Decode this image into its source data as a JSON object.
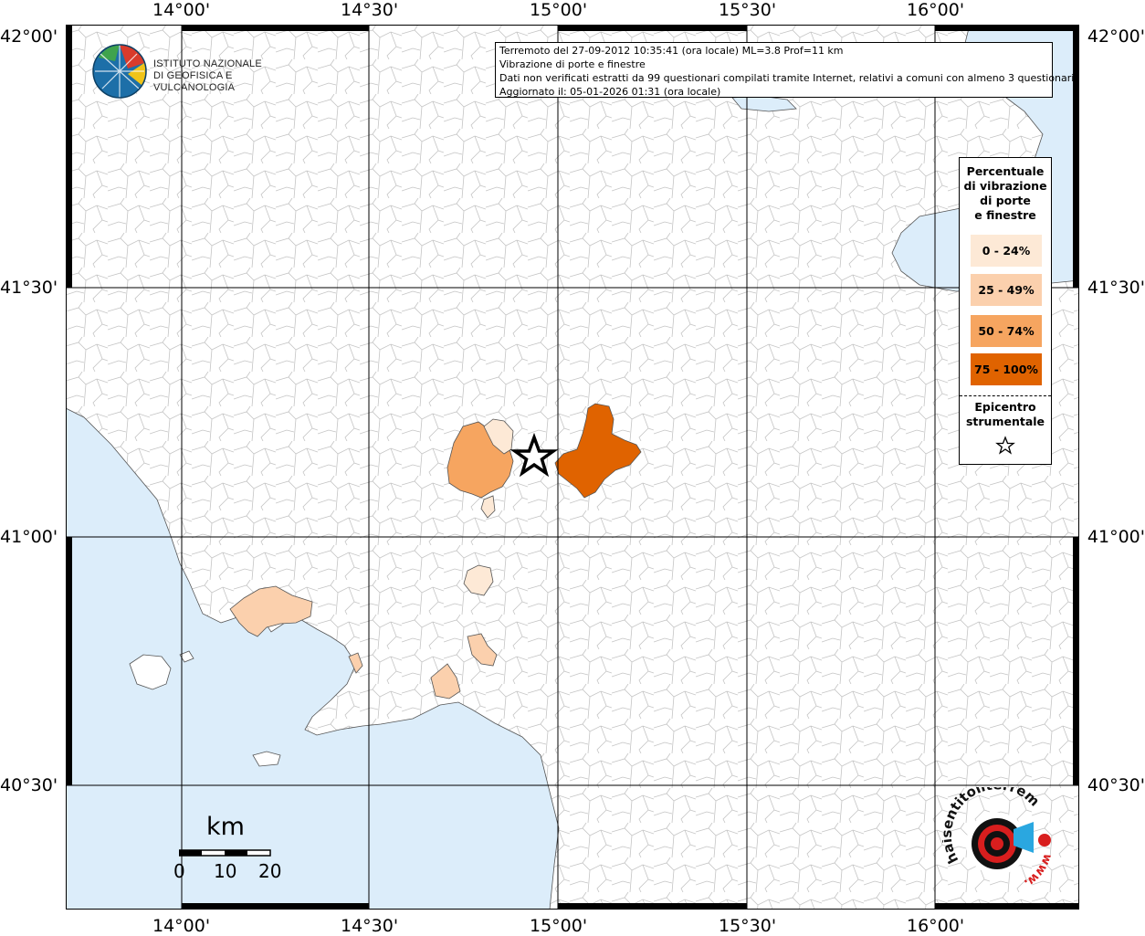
{
  "info_box": {
    "line1": "Terremoto del 27-09-2012 10:35:41 (ora locale) ML=3.8 Prof=11 km",
    "line2": "Vibrazione di porte e finestre",
    "line3": "Dati non verificati estratti da 99 questionari compilati tramite Internet, relativi a comuni con almeno 3 questionari.",
    "line4": "Aggiornato il: 05-01-2026 01:31 (ora locale)"
  },
  "logo": {
    "line1": "ISTITUTO NAZIONALE",
    "line2": "DI GEOFISICA E VULCANOLOGIA"
  },
  "axes": {
    "lon_ticks": [
      "14°00'",
      "14°30'",
      "15°00'",
      "15°30'",
      "16°00'"
    ],
    "lat_ticks": [
      "42°00'",
      "41°30'",
      "41°00'",
      "40°30'"
    ]
  },
  "legend": {
    "title_lines": [
      "Percentuale",
      "di vibrazione",
      "di porte",
      "e finestre"
    ],
    "classes": [
      {
        "label": "0 - 24%",
        "color": "#fde9d6"
      },
      {
        "label": "25 - 49%",
        "color": "#fbd0ad"
      },
      {
        "label": "50 - 74%",
        "color": "#f6a560"
      },
      {
        "label": "75 - 100%",
        "color": "#e06300"
      }
    ],
    "epicenter_lines": [
      "Epicentro",
      "strumentale"
    ]
  },
  "scale_bar": {
    "unit": "km",
    "labels": [
      "0",
      "10",
      "20"
    ]
  },
  "badge": {
    "text": "haisentitoilterremoto.it",
    "www": "www."
  },
  "colors": {
    "sea": "#dcedfa",
    "land": "#ffffff",
    "border": "#bdbdbd",
    "grid": "#000000"
  }
}
